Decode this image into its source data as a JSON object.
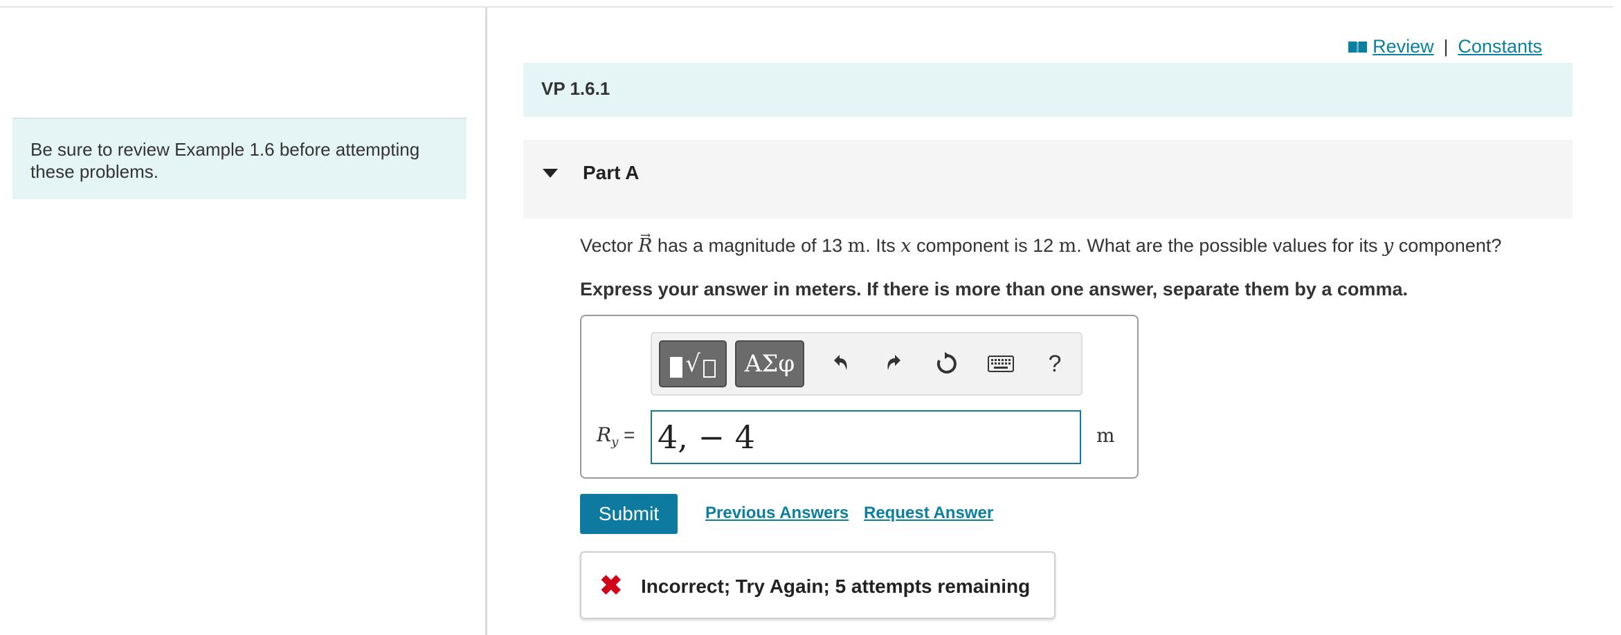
{
  "left_panel": {
    "note": "Be sure to review Example 1.6 before attempting these problems."
  },
  "top_links": {
    "review": "Review",
    "separator": "|",
    "constants": "Constants"
  },
  "header": {
    "title": "VP 1.6.1"
  },
  "part": {
    "title": "Part A"
  },
  "question": {
    "t1": "Vector",
    "vec_symbol": "R",
    "vec_arrow": "→",
    "t2": "has a magnitude of 13",
    "u1": "m",
    "t3": ". Its",
    "x_var": "x",
    "t4": "component is 12",
    "u2": "m",
    "t5": ". What are the possible values for its",
    "y_var": "y",
    "t6": "component?",
    "instruction": "Express your answer in meters. If there is more than one answer, separate them by a comma."
  },
  "toolbar": {
    "symbols_label": "ΑΣφ",
    "help_label": "?"
  },
  "answer": {
    "var": "R",
    "sub": "y",
    "equals": "=",
    "value": "4, − 4",
    "unit": "m"
  },
  "actions": {
    "submit": "Submit",
    "previous_answers": "Previous Answers",
    "request_answer": "Request Answer"
  },
  "feedback": {
    "icon": "✖",
    "message": "Incorrect; Try Again; 5 attempts remaining"
  },
  "colors": {
    "accent": "#0e7aa0",
    "panel_bg": "#e5f4f4",
    "error": "#d0021b"
  }
}
